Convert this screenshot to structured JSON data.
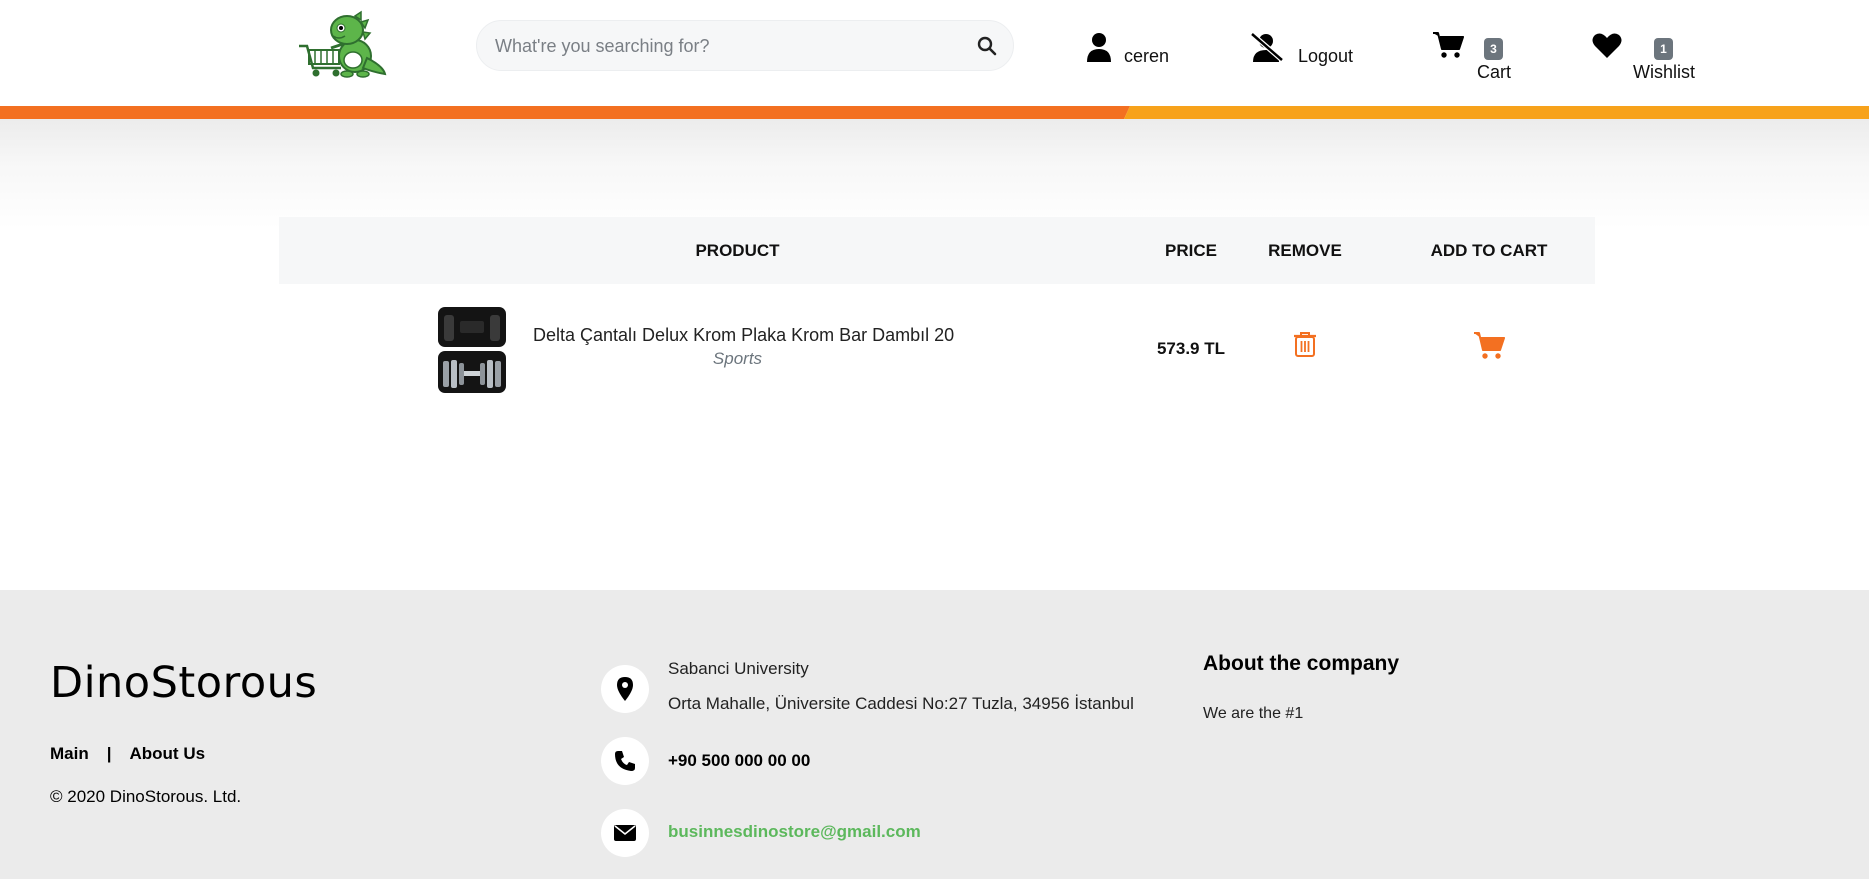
{
  "header": {
    "logo_icon": "dino-shopping-cart-logo",
    "search": {
      "placeholder": "What're you searching for?",
      "value": "",
      "icon": "search-icon"
    },
    "user": {
      "icon": "user-icon",
      "label": "ceren"
    },
    "logout": {
      "icon": "user-slash-icon",
      "label": "Logout"
    },
    "cart": {
      "icon": "cart-icon",
      "label": "Cart",
      "count": "3"
    },
    "wishlist": {
      "icon": "heart-icon",
      "label": "Wishlist",
      "count": "1"
    }
  },
  "colors": {
    "accent": "#f37021",
    "accent_light": "#f7a21b",
    "badge": "#6c757d",
    "email": "#5cb85c",
    "footer_bg": "#ebebeb"
  },
  "table": {
    "headers": {
      "product": "PRODUCT",
      "price": "PRICE",
      "remove": "REMOVE",
      "add_to_cart": "ADD TO CART"
    },
    "rows": [
      {
        "name": "Delta Çantalı Delux Krom Plaka Krom Bar Dambıl 20",
        "category": "Sports",
        "price": "573.9 TL",
        "remove_icon": "trash-icon",
        "add_icon": "cart-icon"
      }
    ]
  },
  "footer": {
    "brand": "DinoStorous",
    "links": {
      "main": "Main",
      "separator": "|",
      "about": "About Us"
    },
    "copyright": "© 2020 DinoStorous. Ltd.",
    "address_line1": "Sabanci University",
    "address_line2": "Orta Mahalle, Üniversite Caddesi No:27 Tuzla, 34956 İstanbul",
    "phone": "+90 500 000 00 00",
    "email": "businnesdinostore@gmail.com",
    "about_title": "About the company",
    "about_text": "We are the #1"
  }
}
